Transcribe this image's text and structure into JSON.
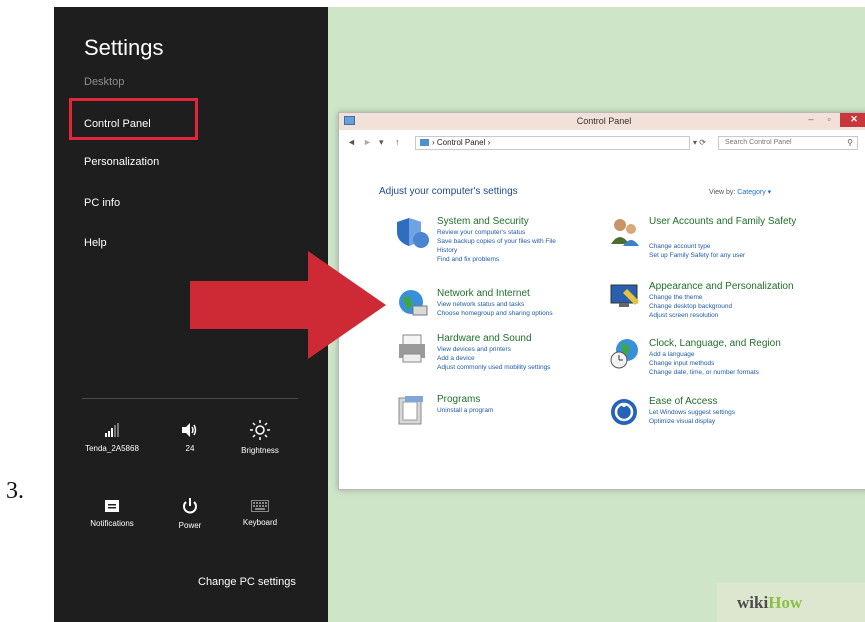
{
  "step": {
    "number": "3."
  },
  "settings": {
    "title": "Settings",
    "items": [
      "Desktop",
      "Control Panel",
      "Personalization",
      "PC info",
      "Help"
    ],
    "tiles": [
      {
        "icon": "network-bars-icon",
        "label": "Tenda_2A5868"
      },
      {
        "icon": "speaker-icon",
        "label": "24"
      },
      {
        "icon": "sun-icon",
        "label": "Brightness"
      },
      {
        "icon": "notifications-icon",
        "label": "Notifications"
      },
      {
        "icon": "power-icon",
        "label": "Power"
      },
      {
        "icon": "keyboard-icon",
        "label": "Keyboard"
      }
    ],
    "change_pc": "Change PC settings"
  },
  "control_panel": {
    "title": "Control Panel",
    "window_buttons": {
      "minimize": "–",
      "maximize": "▫",
      "close": "✕"
    },
    "nav": {
      "back": "◄",
      "forward": "►",
      "recent": "▾",
      "up": "↑"
    },
    "address": "› Control Panel ›",
    "address_tools": "▾  ⟳",
    "search_placeholder": "Search Control Panel",
    "search_icon": "⚲",
    "heading": "Adjust your computer's settings",
    "view_by_label": "View by:",
    "view_by_value": "Category ▾",
    "categories": [
      {
        "icon": "shield-icon",
        "title": "System and Security",
        "links": [
          "Review your computer's status",
          "Save backup copies of your files with File",
          "History",
          "Find and fix problems"
        ]
      },
      {
        "icon": "network-globe-icon",
        "title": "Network and Internet",
        "links": [
          "View network status and tasks",
          "Choose homegroup and sharing options"
        ]
      },
      {
        "icon": "printer-icon",
        "title": "Hardware and Sound",
        "links": [
          "View devices and printers",
          "Add a device",
          "Adjust commonly used mobility settings"
        ]
      },
      {
        "icon": "programs-icon",
        "title": "Programs",
        "links": [
          "Uninstall a program"
        ]
      },
      {
        "icon": "users-icon",
        "title": "User Accounts and Family Safety",
        "links": [
          "Change account type",
          "Set up Family Safety for any user"
        ]
      },
      {
        "icon": "monitor-icon",
        "title": "Appearance and Personalization",
        "links": [
          "Change the theme",
          "Change desktop background",
          "Adjust screen resolution"
        ]
      },
      {
        "icon": "clock-globe-icon",
        "title": "Clock, Language, and Region",
        "links": [
          "Add a language",
          "Change input methods",
          "Change date, time, or number formats"
        ]
      },
      {
        "icon": "ease-of-access-icon",
        "title": "Ease of Access",
        "links": [
          "Let Windows suggest settings",
          "Optimize visual display"
        ]
      }
    ]
  },
  "watermark": {
    "wiki": "wiki",
    "how": "How"
  },
  "colors": {
    "highlight": "#e0283c",
    "arrow": "#cd2a35",
    "desktop": "#cfe5c8",
    "panel": "#1e1e1e"
  }
}
